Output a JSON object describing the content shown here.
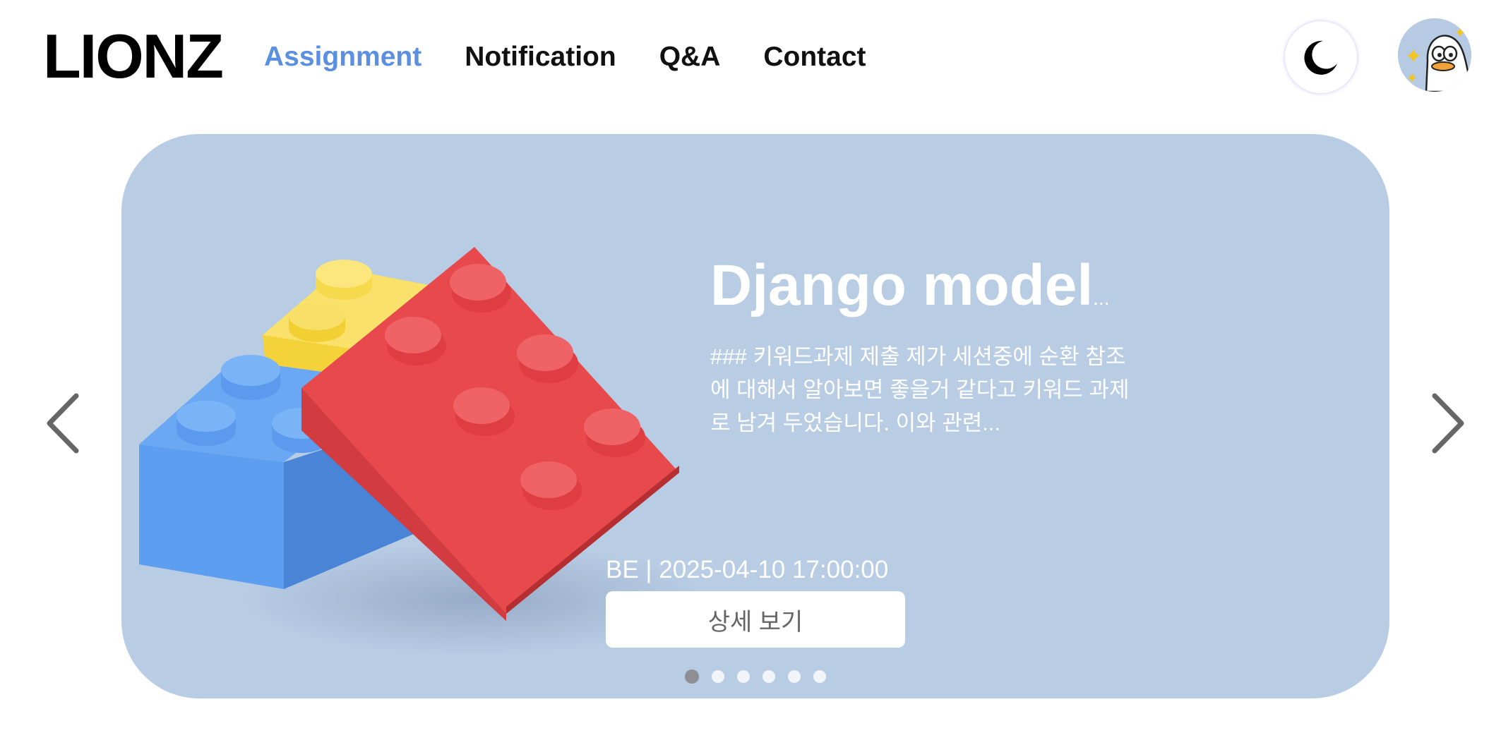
{
  "header": {
    "logo": "LIONZ",
    "nav": [
      {
        "label": "Assignment",
        "active": true
      },
      {
        "label": "Notification",
        "active": false
      },
      {
        "label": "Q&A",
        "active": false
      },
      {
        "label": "Contact",
        "active": false
      }
    ],
    "theme_icon": "moon-icon",
    "avatar_icon": "duck-avatar"
  },
  "carousel": {
    "slide": {
      "title": "Django model",
      "title_ellipsis": "...",
      "description": "### 키워드과제 제출 제가 세션중에 순환 참조에 대해서 알아보면 좋을거 같다고 키워드 과제로 남겨 두었습니다. 이와 관련...",
      "meta": "BE | 2025-04-10 17:00:00",
      "button_label": "상세 보기",
      "image_icon": "lego-bricks-image"
    },
    "dot_count": 6,
    "active_dot": 0,
    "prev_icon": "chevron-left-icon",
    "next_icon": "chevron-right-icon"
  },
  "colors": {
    "accent": "#5b8fe0",
    "carousel_bg": "#b8cce4",
    "text_dark": "#111111",
    "white": "#ffffff"
  }
}
